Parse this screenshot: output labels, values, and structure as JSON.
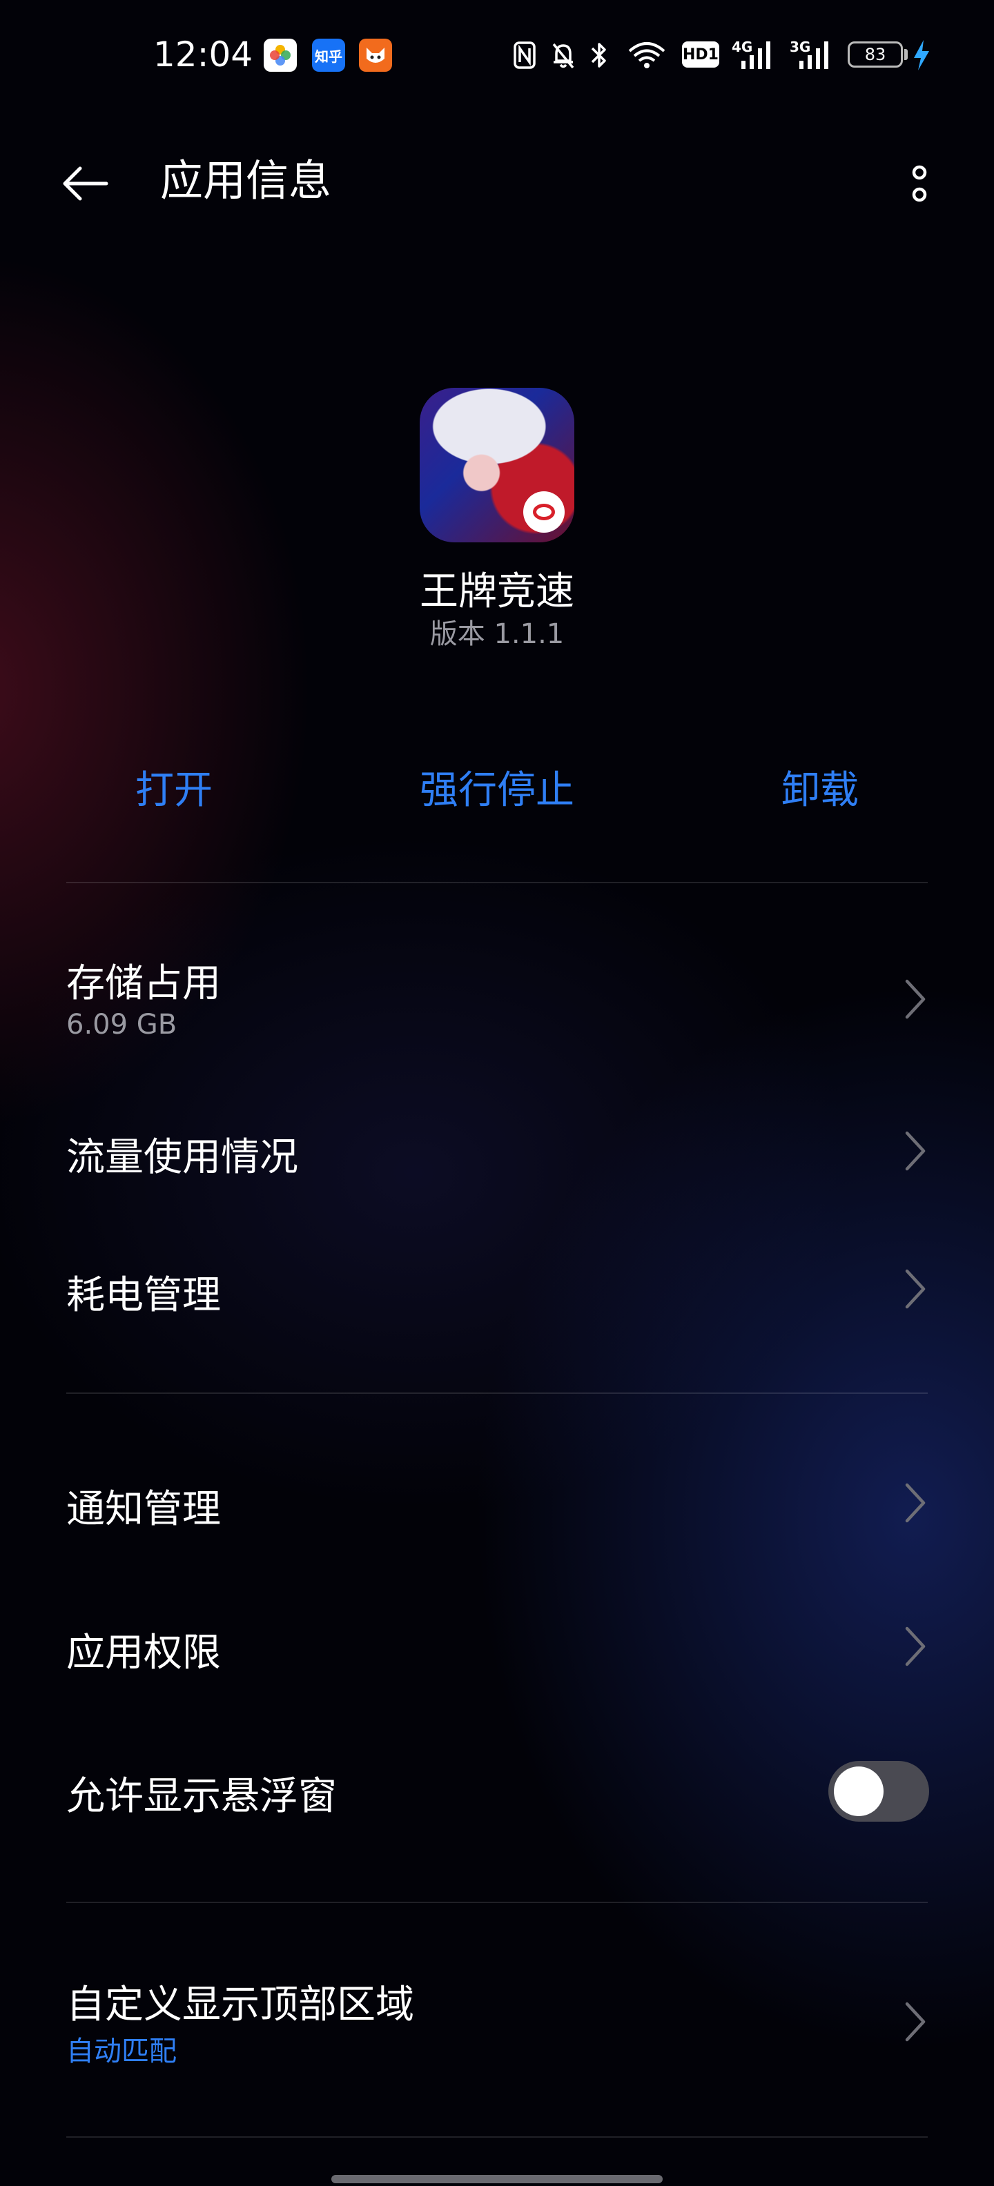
{
  "status_bar": {
    "time": "12:04",
    "zhihu_label": "知乎",
    "hd_label": "HD1",
    "net1_label": "4G",
    "net2_label": "3G",
    "battery_level": "83",
    "icons": [
      "photos-icon",
      "zhihu-icon",
      "fox-app-icon",
      "nfc-icon",
      "bell-off-icon",
      "bluetooth-icon",
      "wifi-icon",
      "signal-icon",
      "battery-icon",
      "charging-icon"
    ]
  },
  "header": {
    "title": "应用信息",
    "back_icon": "arrow-left-icon",
    "more_icon": "more-vertical-icon"
  },
  "app": {
    "name": "王牌竞速",
    "version": "版本 1.1.1"
  },
  "actions": {
    "open": "打开",
    "force_stop": "强行停止",
    "uninstall": "卸载"
  },
  "settings": {
    "storage": {
      "title": "存储占用",
      "value": "6.09 GB"
    },
    "data_usage": {
      "title": "流量使用情况"
    },
    "battery": {
      "title": "耗电管理"
    },
    "notifications": {
      "title": "通知管理"
    },
    "permissions": {
      "title": "应用权限"
    },
    "floating_window": {
      "title": "允许显示悬浮窗",
      "enabled": false
    },
    "top_area": {
      "title": "自定义显示顶部区域",
      "value": "自动匹配"
    }
  },
  "colors": {
    "accent": "#2f7ff5",
    "background": "#020208",
    "secondary_text": "#9a9aa2"
  }
}
